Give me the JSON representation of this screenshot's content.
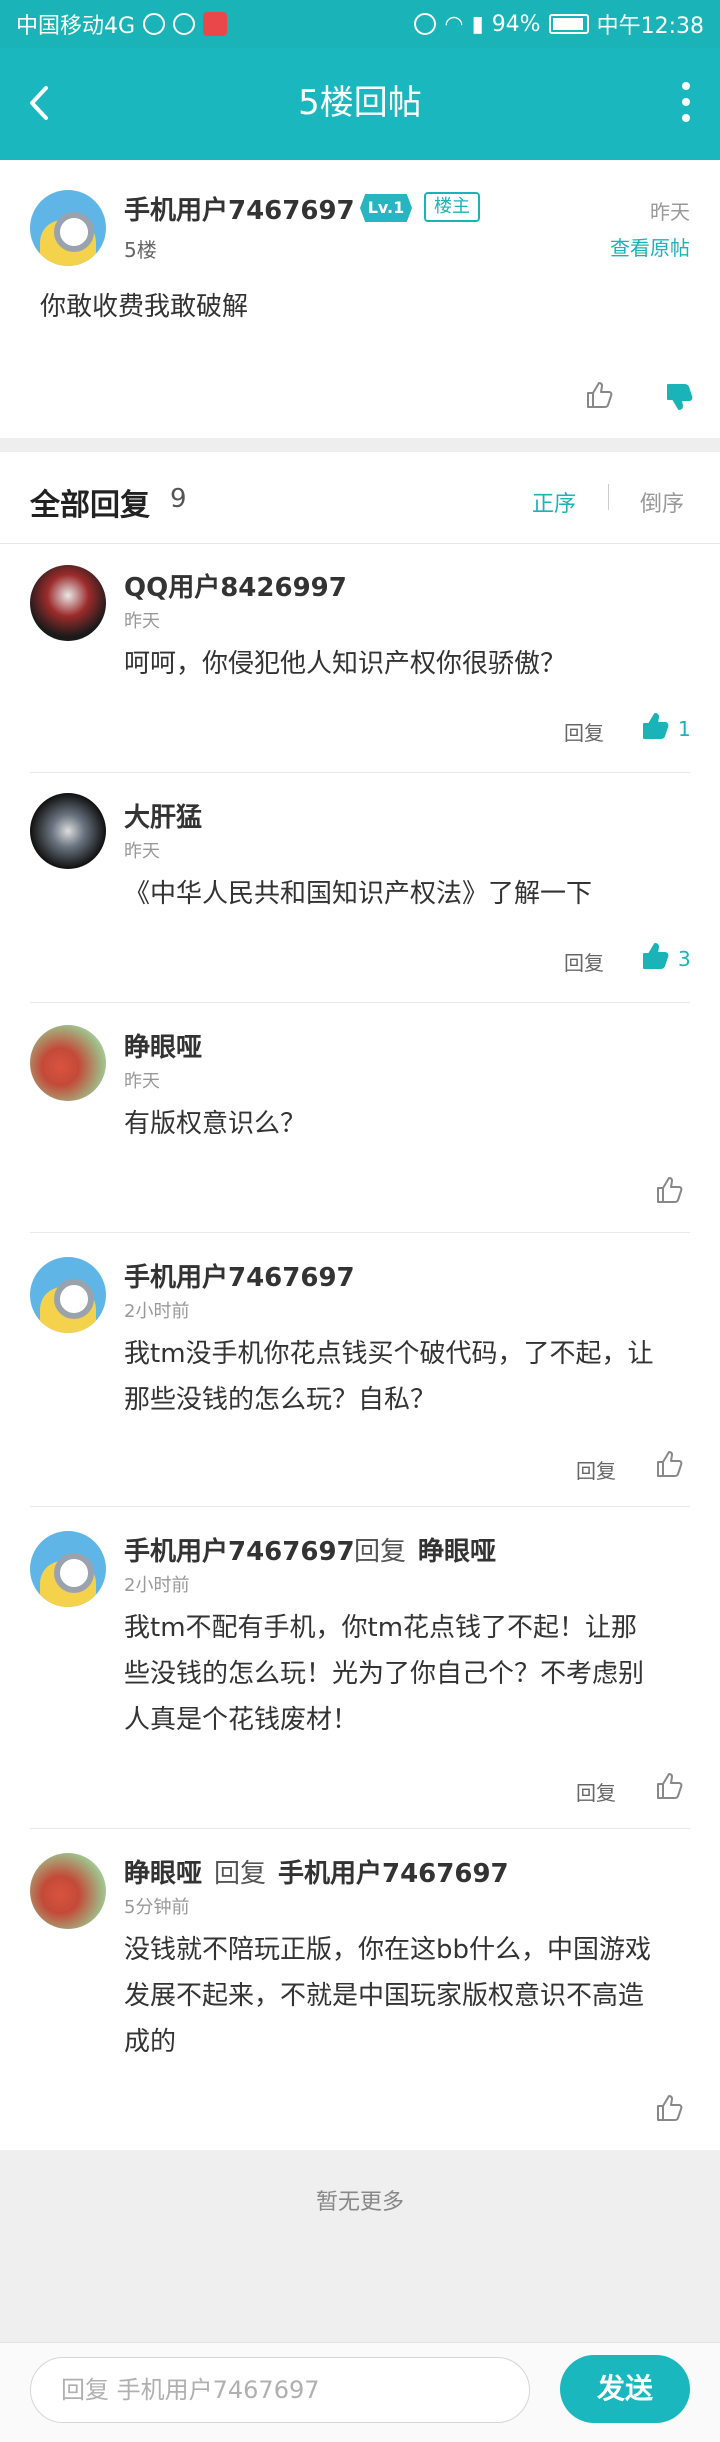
{
  "status_bar": {
    "carrier": "中国移动4G",
    "battery": "94%",
    "time": "中午12:38"
  },
  "header": {
    "title": "5楼回帖"
  },
  "post": {
    "username": "手机用户7467697",
    "level": "Lv.1",
    "owner_badge": "楼主",
    "floor": "5楼",
    "time": "昨天",
    "view_original": "查看原帖",
    "content": "你敢收费我敢破解"
  },
  "replies_header": {
    "label": "全部回复",
    "count": "9",
    "sort_asc": "正序",
    "sort_desc": "倒序"
  },
  "reply_label": "回复",
  "replies": [
    {
      "username": "QQ用户8426997",
      "time": "昨天",
      "content": "呵呵，你侵犯他人知识产权你很骄傲？",
      "likes": "1"
    },
    {
      "username": "大肝猛",
      "time": "昨天",
      "content": "《中华人民共和国知识产权法》了解一下",
      "likes": "3"
    },
    {
      "username": "睁眼哑",
      "time": "昨天",
      "content": "有版权意识么？"
    },
    {
      "username": "手机用户7467697",
      "time": "2小时前",
      "content_line1": "我tm没手机你花点钱买个破代码，了不起，让",
      "content_line2": "那些没钱的怎么玩？自私？"
    },
    {
      "username": "手机用户7467697",
      "reply_word": "回复",
      "reply_to": "睁眼哑",
      "time": "2小时前",
      "content_line1": "我tm不配有手机，你tm花点钱了不起！让那",
      "content_line2": "些没钱的怎么玩！光为了你自己个？不考虑别",
      "content_line3": "人真是个花钱废材！"
    },
    {
      "username": "睁眼哑",
      "reply_word": "回复",
      "reply_to": "手机用户7467697",
      "time": "5分钟前",
      "content_line1": "没钱就不陪玩正版，你在这bb什么，中国游戏",
      "content_line2": "发展不起来，不就是中国玩家版权意识不高造",
      "content_line3": "成的"
    }
  ],
  "no_more": "暂无更多",
  "footer": {
    "input_placeholder": "回复 手机用户7467697",
    "send_label": "发送"
  },
  "colors": {
    "accent": "#1ab8be",
    "header_bg": "#1ab8be"
  }
}
